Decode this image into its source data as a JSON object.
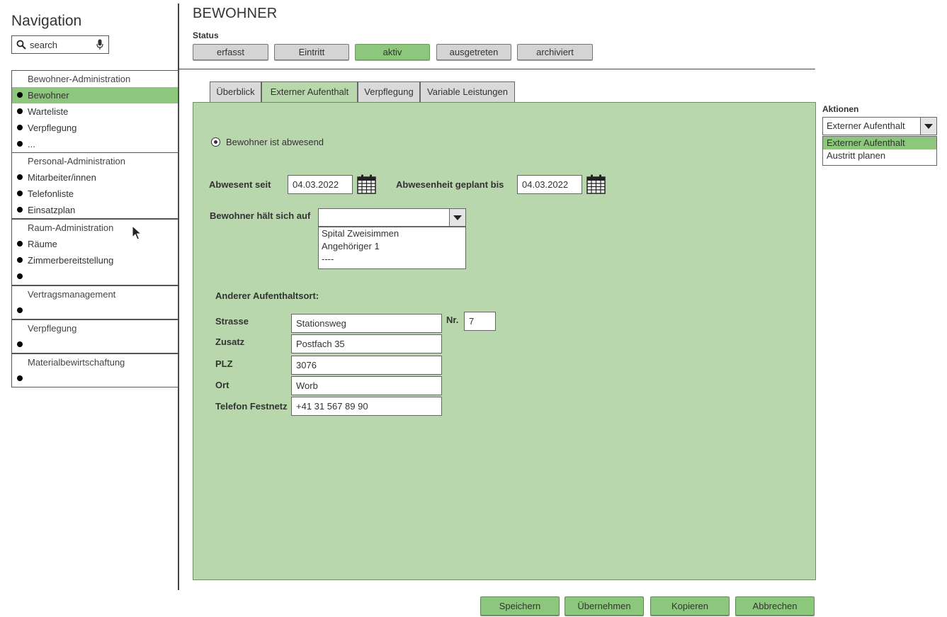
{
  "nav": {
    "title": "Navigation",
    "search_placeholder": "search",
    "groups": [
      {
        "title": "Bewohner-Administration",
        "items": [
          "Bewohner",
          "Warteliste",
          "Verpflegung",
          "..."
        ]
      },
      {
        "title": "Personal-Administration",
        "items": [
          "Mitarbeiter/innen",
          "Telefonliste",
          "Einsatzplan"
        ]
      },
      {
        "title": "Raum-Administration",
        "items": [
          "Räume",
          "Zimmerbereitstellung",
          ""
        ]
      },
      {
        "title": "Vertragsmanagement",
        "items": [
          ""
        ]
      },
      {
        "title": "Verpflegung",
        "items": [
          ""
        ]
      },
      {
        "title": "Materialbewirtschaftung",
        "items": [
          ""
        ]
      }
    ],
    "active_item": "Bewohner"
  },
  "page": {
    "title": "BEWOHNER",
    "status_label": "Status",
    "status_buttons": [
      "erfasst",
      "Eintritt",
      "aktiv",
      "ausgetreten",
      "archiviert"
    ],
    "status_active": "aktiv"
  },
  "tabs": [
    "Überblick",
    "Externer Aufenthalt",
    "Verpflegung",
    "Variable Leistungen"
  ],
  "active_tab": "Externer Aufenthalt",
  "form": {
    "radio_label": "Bewohner ist abwesend",
    "absent_since_label": "Abwesent seit",
    "absent_since_value": "04.03.2022",
    "planned_until_label": "Abwesenheit geplant bis",
    "planned_until_value": "04.03.2022",
    "location_label": "Bewohner hält sich auf",
    "location_value": "",
    "location_options": [
      "Spital Zweisimmen",
      "Angehöriger 1",
      "----"
    ],
    "other_location_label": "Anderer Aufenthaltsort:",
    "street_label": "Strasse",
    "street_value": "Stationsweg",
    "nr_label": "Nr.",
    "nr_value": "7",
    "addition_label": "Zusatz",
    "addition_value": "Postfach 35",
    "zip_label": "PLZ",
    "zip_value": "3076",
    "city_label": "Ort",
    "city_value": "Worb",
    "phone_label": "Telefon Festnetz",
    "phone_value": "+41 31 567 89 90"
  },
  "actions": {
    "label": "Aktionen",
    "selected": "Externer Aufenthalt",
    "options": [
      "Externer Aufenthalt",
      "Austritt planen"
    ]
  },
  "buttons": {
    "save": "Speichern",
    "apply": "Übernehmen",
    "copy": "Kopieren",
    "cancel": "Abbrechen"
  },
  "colors": {
    "accent": "#8dc77e",
    "panel": "#b8d7ac",
    "status_default": "#d4d4d4"
  }
}
